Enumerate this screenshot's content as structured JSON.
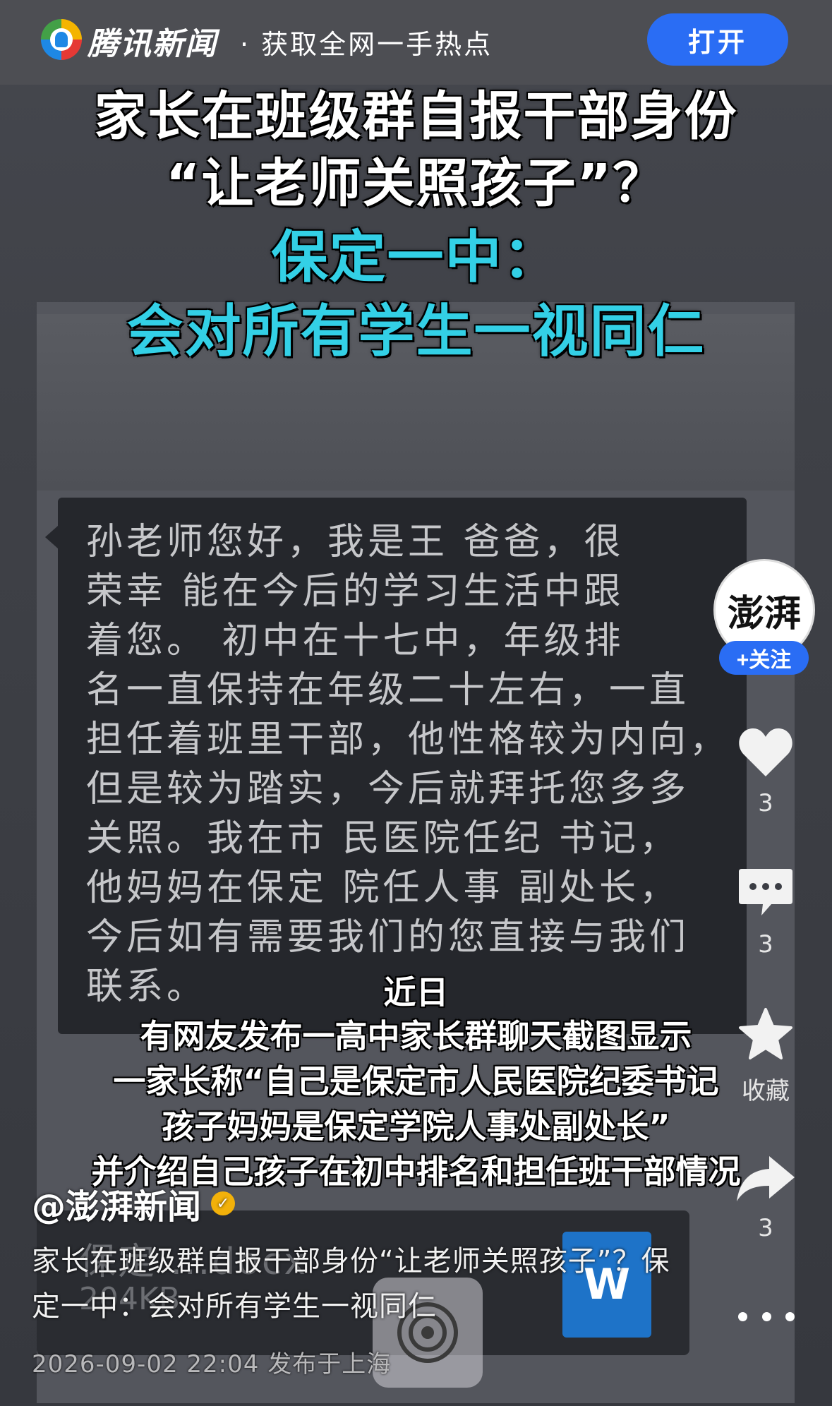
{
  "topbar": {
    "brand": "腾讯新闻",
    "slogan": "· 获取全网一手热点",
    "open_label": "打开"
  },
  "poster": {
    "headline_line1": "家长在班级群自报干部身份",
    "headline_line2": "“让老师关照孩子”？",
    "headline_line3": "保定一中：",
    "headline_line4": "会对所有学生一视同仁",
    "chat_lines": [
      "孙老师您好，我是王  爸爸，很",
      "荣幸   能在今后的学习生活中跟",
      "着您。    初中在十七中，年级排",
      "名一直保持在年级二十左右，一直",
      "担任着班里干部，他性格较为内向，",
      "但是较为踏实，今后就拜托您多多",
      "关照。我在市  民医院任纪  书记，",
      "他妈妈在保定  院任人事  副处长，",
      "今后如有需要我们的您直接与我们",
      "联系。"
    ],
    "captions": [
      "近日",
      "有网友发布一高中家长群聊天截图显示",
      "一家长称“自己是保定市人民医院纪委书记",
      "孩子妈妈是保定学院人事处副处长”",
      "并介绍自己孩子在初中排名和担任班干部情况"
    ],
    "file_name": "保定    ...docx",
    "file_size": "204KB",
    "file_icon_letter": "W"
  },
  "rail": {
    "avatar_text": "澎湃",
    "follow_label": "+关注",
    "like_count": "3",
    "comment_count": "3",
    "favorite_label": "收藏",
    "share_count": "3"
  },
  "post": {
    "author": "@澎湃新闻",
    "description": "家长在班级群自报干部身份“让老师关照孩子”？保定一中：会对所有学生一视同仁",
    "meta": "2026-09-02 22:04 发布于上海"
  },
  "colors": {
    "accent_blue": "#2a6df4",
    "headline_cyan": "#33d0e6",
    "verified_gold": "#f2b10a"
  }
}
